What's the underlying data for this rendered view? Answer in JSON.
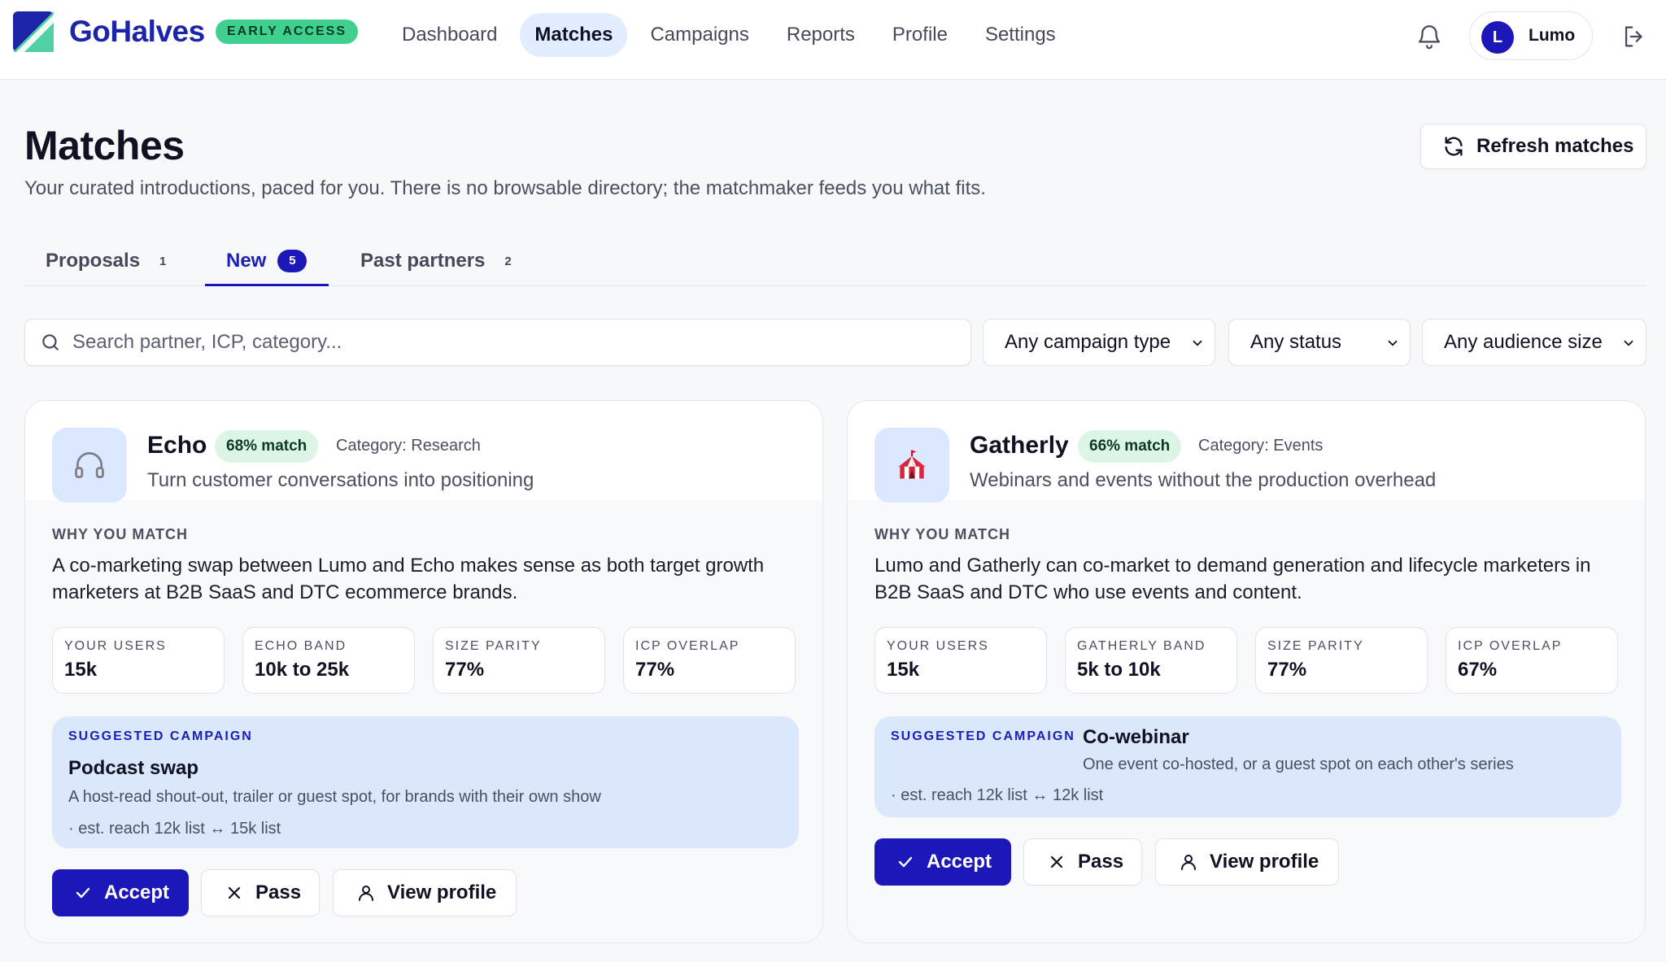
{
  "app": {
    "brand": "GoHalves",
    "badge": "EARLY ACCESS",
    "accent": "#1c17b8"
  },
  "nav": {
    "items": [
      {
        "label": "Dashboard"
      },
      {
        "label": "Matches",
        "active": true
      },
      {
        "label": "Campaigns"
      },
      {
        "label": "Reports"
      },
      {
        "label": "Profile"
      },
      {
        "label": "Settings"
      }
    ]
  },
  "user": {
    "initial": "L",
    "name": "Lumo"
  },
  "icons": [
    "logo-mark-icon",
    "bell-icon",
    "logout-icon",
    "refresh-icon",
    "search-icon",
    "chevron-down-icon",
    "check-icon",
    "x-icon",
    "user-icon",
    "headphones-icon",
    "circus-tent-icon"
  ],
  "page": {
    "title": "Matches",
    "subtitle": "Your curated introductions, paced for you. There is no browsable directory; the matchmaker feeds you what fits.",
    "refresh_label": "Refresh matches"
  },
  "tabs": [
    {
      "label": "Proposals",
      "count": "1"
    },
    {
      "label": "New",
      "count": "5",
      "active": true
    },
    {
      "label": "Past partners",
      "count": "2"
    }
  ],
  "filters": {
    "search_placeholder": "Search partner, ICP, category...",
    "campaign_type": "Any campaign type",
    "status": "Any status",
    "audience_size": "Any audience size"
  },
  "cards": [
    {
      "name": "Echo",
      "match": "68% match",
      "category": "Category: Research",
      "tagline": "Turn customer conversations into positioning",
      "why_label": "WHY YOU MATCH",
      "why_text": "A co-marketing swap between Lumo and Echo makes sense as both target growth marketers at B2B SaaS and DTC ecommerce brands.",
      "stats": [
        {
          "label": "YOUR USERS",
          "value": "15k"
        },
        {
          "label": "ECHO BAND",
          "value": "10k to 25k"
        },
        {
          "label": "SIZE PARITY",
          "value": "77%"
        },
        {
          "label": "ICP OVERLAP",
          "value": "77%"
        }
      ],
      "suggest_label": "SUGGESTED CAMPAIGN",
      "suggest_title": "Podcast swap",
      "suggest_desc": "A host-read shout-out, trailer or guest spot, for brands with their own show",
      "suggest_reach": "· est. reach 12k list ↔ 15k list",
      "accept": "Accept",
      "pass": "Pass",
      "view": "View profile"
    },
    {
      "name": "Gatherly",
      "match": "66% match",
      "category": "Category: Events",
      "tagline": "Webinars and events without the production overhead",
      "why_label": "WHY YOU MATCH",
      "why_text": "Lumo and Gatherly can co-market to demand generation and lifecycle marketers in B2B SaaS and DTC who use events and content.",
      "stats": [
        {
          "label": "YOUR USERS",
          "value": "15k"
        },
        {
          "label": "GATHERLY BAND",
          "value": "5k to 10k"
        },
        {
          "label": "SIZE PARITY",
          "value": "77%"
        },
        {
          "label": "ICP OVERLAP",
          "value": "67%"
        }
      ],
      "suggest_label": "SUGGESTED CAMPAIGN",
      "suggest_title": "Co-webinar",
      "suggest_desc": "One event co-hosted, or a guest spot on each other's series",
      "suggest_reach": "· est. reach 12k list ↔ 12k list",
      "accept": "Accept",
      "pass": "Pass",
      "view": "View profile"
    }
  ]
}
